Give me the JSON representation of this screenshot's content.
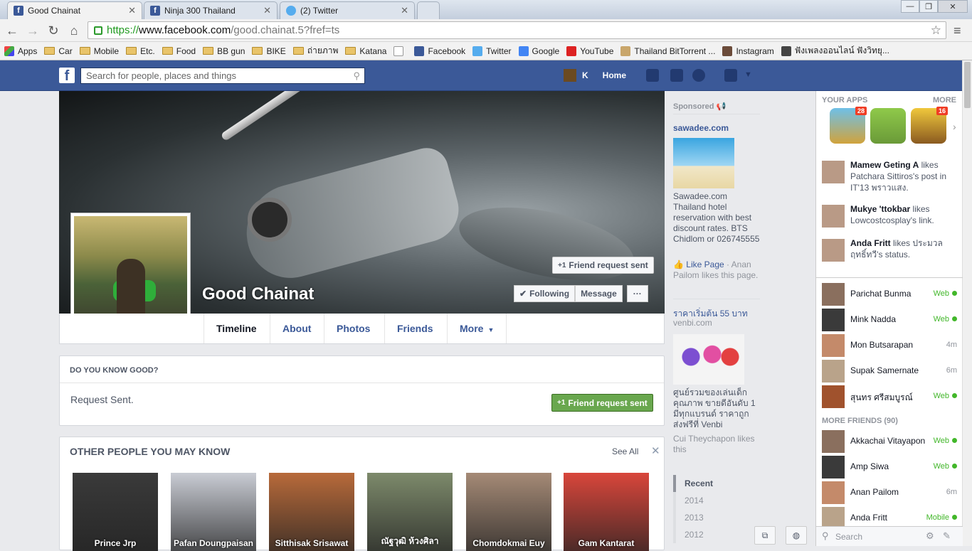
{
  "browser": {
    "tabs": [
      {
        "title": "Good Chainat",
        "icon": "facebook-icon"
      },
      {
        "title": "Ninja 300 Thailand",
        "icon": "facebook-icon"
      },
      {
        "title": "(2) Twitter",
        "icon": "twitter-icon"
      }
    ],
    "url": {
      "scheme": "https://",
      "domain": "www.facebook.com",
      "path": "/good.chainat.5?fref=ts"
    },
    "bookmarks": [
      {
        "label": "Apps",
        "icon": "apps-icon"
      },
      {
        "label": "Car",
        "icon": "folder-icon"
      },
      {
        "label": "Mobile",
        "icon": "folder-icon"
      },
      {
        "label": "Etc.",
        "icon": "folder-icon"
      },
      {
        "label": "Food",
        "icon": "folder-icon"
      },
      {
        "label": "BB gun",
        "icon": "folder-icon"
      },
      {
        "label": "BIKE",
        "icon": "folder-icon"
      },
      {
        "label": "ถ่ายภาพ",
        "icon": "folder-icon"
      },
      {
        "label": "Katana",
        "icon": "folder-icon"
      },
      {
        "label": "",
        "icon": "page-icon"
      },
      {
        "label": "Facebook",
        "icon": "facebook-icon"
      },
      {
        "label": "Twitter",
        "icon": "twitter-icon"
      },
      {
        "label": "Google",
        "icon": "google-icon"
      },
      {
        "label": "YouTube",
        "icon": "youtube-icon"
      },
      {
        "label": "Thailand BitTorrent ...",
        "icon": "torrent-icon"
      },
      {
        "label": "Instagram",
        "icon": "instagram-icon"
      },
      {
        "label": "ฟังเพลงออนไลน์ ฟังวิทยุ...",
        "icon": "radio-icon"
      }
    ]
  },
  "fb": {
    "search_placeholder": "Search for people, places and things",
    "user_initial": "K",
    "home_label": "Home"
  },
  "profile": {
    "name": "Good Chainat",
    "friend_request_sent": "Friend request sent",
    "following": "Following",
    "message": "Message",
    "more_dots": "···",
    "tabs": [
      "Timeline",
      "About",
      "Photos",
      "Friends",
      "More"
    ]
  },
  "know": {
    "heading": "DO YOU KNOW GOOD?",
    "status": "Request Sent.",
    "button": "Friend request sent"
  },
  "pymk": {
    "heading": "OTHER PEOPLE YOU MAY KNOW",
    "see_all": "See All",
    "close": "✕",
    "people": [
      {
        "name": "Prince Jrp",
        "color": "#3a3a3a"
      },
      {
        "name": "Pafan Doungpaisan",
        "color": "#c9ccd4"
      },
      {
        "name": "Sitthisak Srisawat",
        "color": "#b86a3a"
      },
      {
        "name": "ณัฐวุฒิ ห้วงศิลา",
        "color": "#7d8a6b"
      },
      {
        "name": "Chomdokmai Euy",
        "color": "#a58a76"
      },
      {
        "name": "Gam Kantarat",
        "color": "#d9463b"
      }
    ]
  },
  "ads": {
    "sponsored": "Sponsored",
    "ad1": {
      "title": "sawadee.com",
      "text": "Sawadee.com Thailand hotel reservation with best discount rates. BTS Chidlom or 026745555",
      "like": "Like Page",
      "social": " · Anan Pailom likes this page."
    },
    "ad2": {
      "title": "ราคาเริ่มต้น 55 บาท",
      "sub": "venbi.com",
      "text": "ศูนย์รวมของเล่นเด็กคุณภาพ ขายดีอันดับ 1 มีทุกแบรนด์ ราคาถูก ส่งฟรีที่ Venbi",
      "social": "Cui Theychapon likes this"
    },
    "years": [
      "Recent",
      "2014",
      "2013",
      "2012"
    ]
  },
  "sidebar": {
    "apps_heading": "YOUR APPS",
    "apps_more": "MORE",
    "apps": [
      {
        "badge": "28",
        "icon": "game-icon"
      },
      {
        "badge": "",
        "icon": "talking-tom-icon"
      },
      {
        "badge": "16",
        "icon": "farm-game-icon"
      }
    ],
    "ticker": [
      {
        "name": "Mamew Geting A",
        "text": " likes Patchara Sittiros's post in IT'13 พราวแสง."
      },
      {
        "name": "Mukye 'ttokbar",
        "text": " likes Lowcostcosplay's link."
      },
      {
        "name": "Anda Fritt",
        "text": " likes ประมวล ฤทธิ์ทวี's status."
      }
    ],
    "online": [
      {
        "name": "Parichat Bunma",
        "status": "Web"
      },
      {
        "name": "Mink Nadda",
        "status": "Web"
      },
      {
        "name": "Mon Butsarapan",
        "status": "4m"
      },
      {
        "name": "Supak Samernate",
        "status": "6m"
      },
      {
        "name": "สุนทร ศรีสมบูรณ์",
        "status": "Web"
      }
    ],
    "more_friends": "MORE FRIENDS (90)",
    "friends": [
      {
        "name": "Akkachai Vitayapon",
        "status": "Web"
      },
      {
        "name": "Amp Siwa",
        "status": "Web"
      },
      {
        "name": "Anan Pailom",
        "status": "6m"
      },
      {
        "name": "Anda Fritt",
        "status": "Mobile"
      }
    ],
    "search": "Search"
  }
}
